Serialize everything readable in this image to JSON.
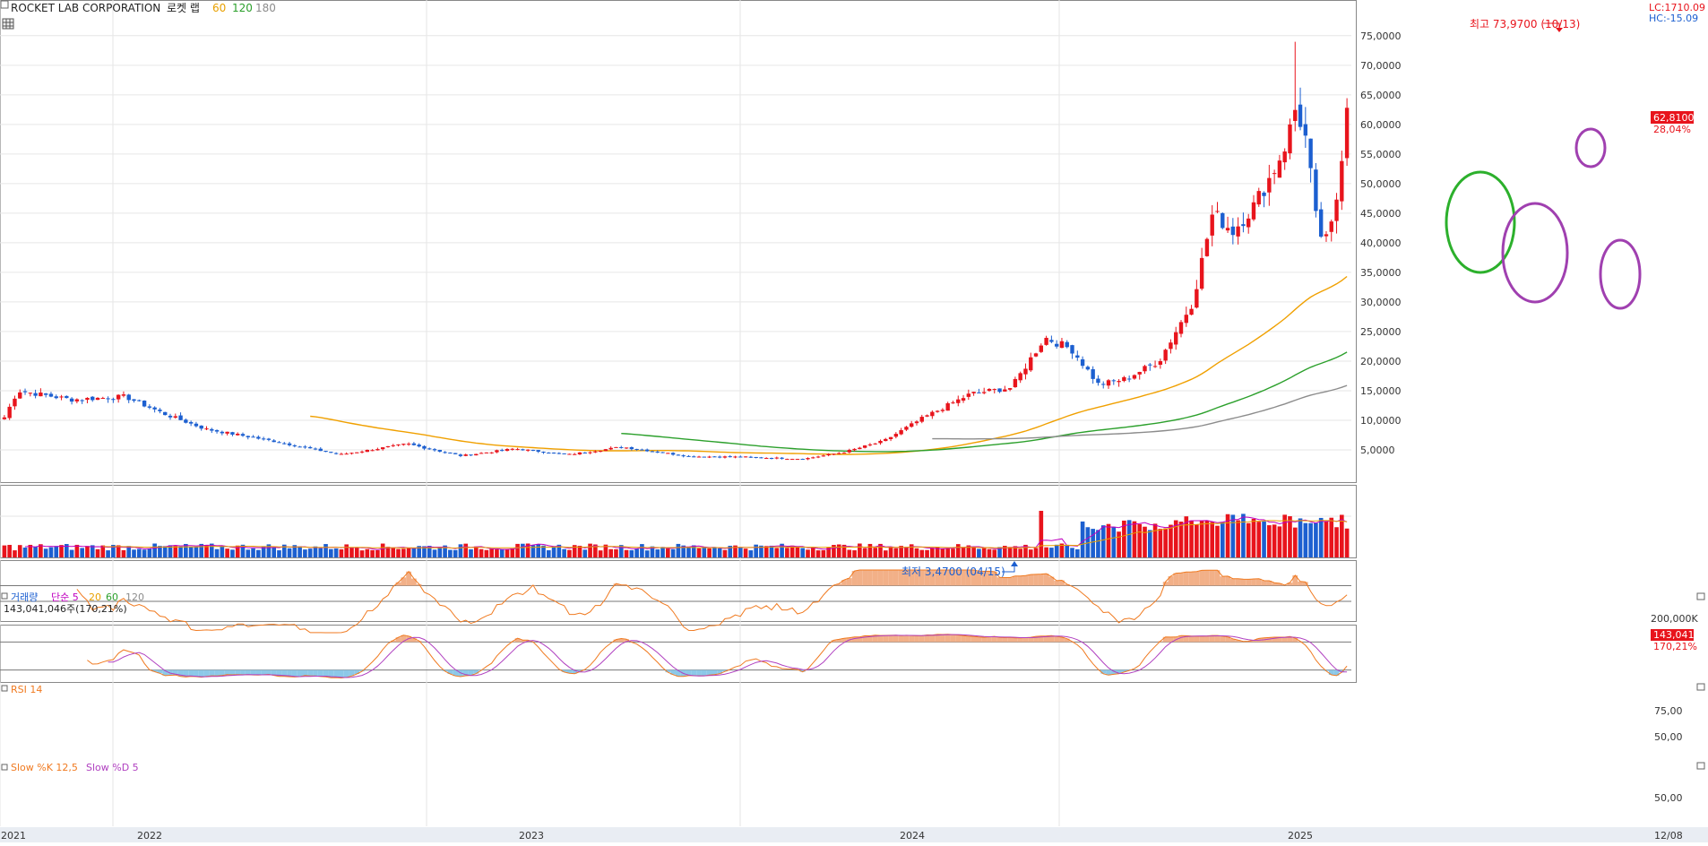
{
  "header": {
    "title": "ROCKET LAB CORPORATION",
    "subtitle": "로켓 랩",
    "ma_labels": [
      {
        "text": "60",
        "color": "#e8a000"
      },
      {
        "text": "120",
        "color": "#2ca02c"
      },
      {
        "text": "180",
        "color": "#8c8c8c"
      }
    ],
    "lc": "LC:1710.09",
    "hc": "HC:-15.09"
  },
  "price_panel": {
    "y_ticks": [
      "75,0000",
      "70,0000",
      "65,0000",
      "60,0000",
      "55,0000",
      "50,0000",
      "45,0000",
      "40,0000",
      "35,0000",
      "30,0000",
      "25,0000",
      "20,0000",
      "15,0000",
      "10,0000",
      "5,0000"
    ],
    "high_note": "최고 73,9700 (10/13)",
    "low_note": "최저 3,4700 (04/15)",
    "last_price": "62,8100",
    "last_change": "28,04%"
  },
  "volume_panel": {
    "title": "거래량",
    "ma_labels": [
      {
        "text": "단순 5",
        "color": "#c000c0"
      },
      {
        "text": "20",
        "color": "#e8a000"
      },
      {
        "text": "60",
        "color": "#2ca02c"
      },
      {
        "text": "120",
        "color": "#8c8c8c"
      }
    ],
    "value_line": "143,041,046주(170,21%)",
    "y_tick": "200,000K",
    "last_volume": "143,041K",
    "last_pct": "170,21%"
  },
  "rsi_panel": {
    "title": "RSI 14",
    "y_ticks": [
      "75,00",
      "50,00"
    ]
  },
  "stoch_panel": {
    "title_k": "Slow %K 12,5",
    "title_d": "Slow %D 5",
    "y_tick": "50,00"
  },
  "x_axis": {
    "labels": [
      "2021",
      "2022",
      "2023",
      "2024",
      "2025",
      "12/08"
    ]
  },
  "colors": {
    "up": "#e8141c",
    "down": "#1c5fd0",
    "ma60": "#f0a000",
    "ma120": "#2ca02c",
    "ma180": "#8c8c8c",
    "rsi": "#f07a20",
    "stoch_k": "#f07a20",
    "stoch_d": "#b040c0",
    "highlight_green": "#2cb02c",
    "highlight_purple": "#a040b0"
  },
  "chart_data": {
    "type": "candlestick",
    "period": "weekly",
    "title": "ROCKET LAB CORPORATION",
    "ylim": [
      0,
      78
    ],
    "x_range": [
      "2021",
      "12/08"
    ],
    "year_ticks": [
      "2021",
      "2022",
      "2023",
      "2024",
      "2025"
    ],
    "grid": true,
    "moving_averages": [
      60,
      120,
      180
    ],
    "anchors": [
      {
        "t": 0.0,
        "v": 10.5
      },
      {
        "t": 0.01,
        "v": 15
      },
      {
        "t": 0.05,
        "v": 13.5
      },
      {
        "t": 0.09,
        "v": 14
      },
      {
        "t": 0.12,
        "v": 11
      },
      {
        "t": 0.15,
        "v": 8.5
      },
      {
        "t": 0.2,
        "v": 6.5
      },
      {
        "t": 0.25,
        "v": 4.2
      },
      {
        "t": 0.3,
        "v": 6.0
      },
      {
        "t": 0.34,
        "v": 4.0
      },
      {
        "t": 0.38,
        "v": 5.2
      },
      {
        "t": 0.42,
        "v": 4.2
      },
      {
        "t": 0.46,
        "v": 5.5
      },
      {
        "t": 0.51,
        "v": 3.9
      },
      {
        "t": 0.55,
        "v": 3.8
      },
      {
        "t": 0.595,
        "v": 3.47
      },
      {
        "t": 0.625,
        "v": 4.6
      },
      {
        "t": 0.655,
        "v": 6.5
      },
      {
        "t": 0.685,
        "v": 10.5
      },
      {
        "t": 0.72,
        "v": 14.5
      },
      {
        "t": 0.75,
        "v": 15.5
      },
      {
        "t": 0.775,
        "v": 24
      },
      {
        "t": 0.795,
        "v": 22
      },
      {
        "t": 0.815,
        "v": 16
      },
      {
        "t": 0.835,
        "v": 17
      },
      {
        "t": 0.86,
        "v": 20
      },
      {
        "t": 0.885,
        "v": 30
      },
      {
        "t": 0.9,
        "v": 45
      },
      {
        "t": 0.915,
        "v": 42
      },
      {
        "t": 0.93,
        "v": 46
      },
      {
        "t": 0.945,
        "v": 52
      },
      {
        "t": 0.955,
        "v": 57
      },
      {
        "t": 0.962,
        "v": 63
      },
      {
        "t": 0.97,
        "v": 57
      },
      {
        "t": 0.978,
        "v": 42
      },
      {
        "t": 0.986,
        "v": 40
      },
      {
        "t": 0.992,
        "v": 47
      },
      {
        "t": 1.0,
        "v": 62.81
      }
    ],
    "high": {
      "value": 73.97,
      "date": "10/13"
    },
    "low": {
      "value": 3.47,
      "date": "04/15"
    },
    "last": {
      "price": 62.81,
      "change_pct": 28.04
    },
    "volume": {
      "last": 143041046,
      "ratio_pct": 170.21,
      "ylim": [
        0,
        220000
      ]
    },
    "rsi": {
      "period": 14,
      "levels": [
        75,
        50
      ]
    },
    "stochastic": {
      "k": "12,5",
      "d": "5",
      "level": 50
    }
  }
}
